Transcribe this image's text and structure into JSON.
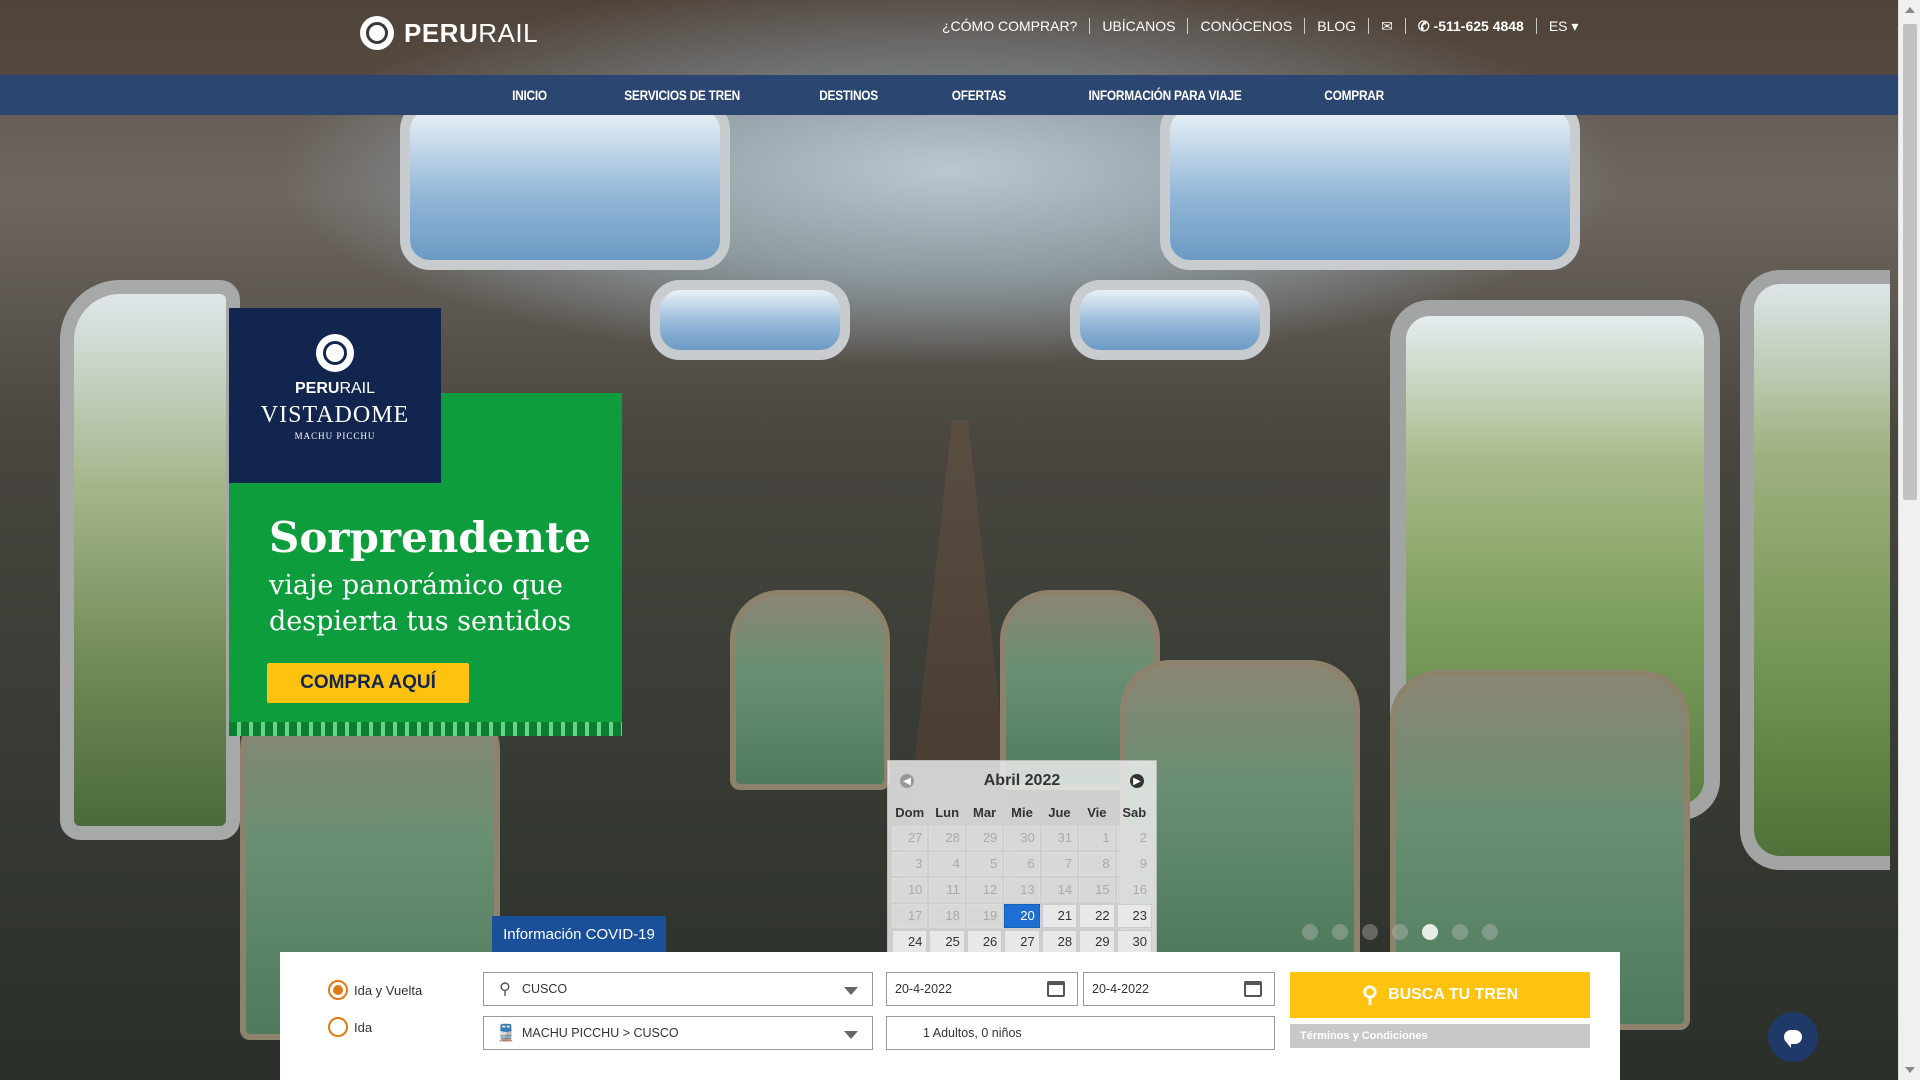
{
  "brand": {
    "name_bold": "PERU",
    "name_light": "RAIL"
  },
  "toplinks": {
    "how_to_buy": "¿CÓMO COMPRAR?",
    "locate_us": "UBÍCANOS",
    "about": "CONÓCENOS",
    "blog": "BLOG",
    "phone": "-511-625 4848",
    "language": "ES"
  },
  "nav": [
    "INICIO",
    "SERVICIOS DE TREN",
    "DESTINOS",
    "OFERTAS",
    "INFORMACIÓN PARA VIAJE",
    "COMPRAR"
  ],
  "promo": {
    "brand_bold": "PERU",
    "brand_light": "RAIL",
    "product": "VISTADOME",
    "location": "MACHU PICCHU",
    "headline": "Sorprendente",
    "subline1": "viaje panorámico que",
    "subline2": "despierta tus sentidos",
    "cta": "COMPRA AQUÍ"
  },
  "calendar": {
    "title": "Abril 2022",
    "days_of_week": [
      "Dom",
      "Lun",
      "Mar",
      "Mie",
      "Jue",
      "Vie",
      "Sab"
    ],
    "weeks": [
      [
        "27",
        "28",
        "29",
        "30",
        "31",
        "1",
        "2"
      ],
      [
        "3",
        "4",
        "5",
        "6",
        "7",
        "8",
        "9"
      ],
      [
        "10",
        "11",
        "12",
        "13",
        "14",
        "15",
        "16"
      ],
      [
        "17",
        "18",
        "19",
        "20",
        "21",
        "22",
        "23"
      ],
      [
        "24",
        "25",
        "26",
        "27",
        "28",
        "29",
        "30"
      ]
    ]
  },
  "covid_tab": "Información COVID-19",
  "search": {
    "trip_roundtrip": "Ida y Vuelta",
    "trip_oneway": "Ida",
    "origin": "CUSCO",
    "route": "MACHU PICCHU > CUSCO",
    "depart_date": "20-4-2022",
    "return_date": "20-4-2022",
    "passengers": "1 Adultos, 0 niños",
    "button": "BUSCA TU TREN",
    "terms": "Términos y Condiciones"
  },
  "icons": {
    "logo": "perurail-emblem",
    "mail": "mail-icon",
    "phone": "phone-icon",
    "location": "map-pin-icon",
    "train": "train-icon",
    "calendar": "calendar-icon",
    "search": "magnifier-icon",
    "chat": "chat-bubble-icon"
  },
  "colors": {
    "nav_bg": "#2b4670",
    "accent_yellow": "#ffc20e",
    "promo_green": "#0e9d3d",
    "promo_navy": "#12254f",
    "selected_day": "#1e6fd4",
    "radio_orange": "#e07a12"
  }
}
